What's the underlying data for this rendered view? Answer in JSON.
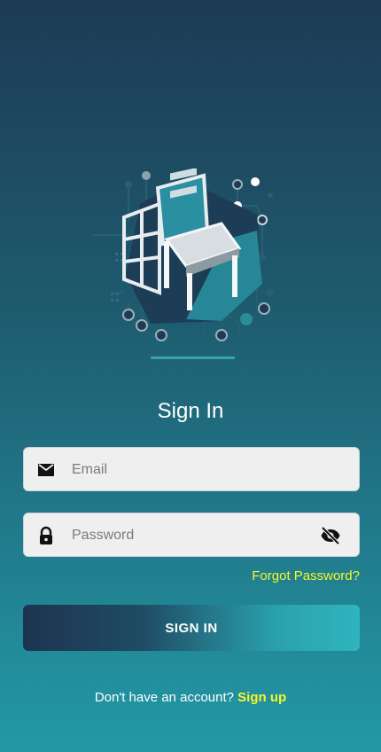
{
  "logo": {
    "icon": "chair-circuit-logo"
  },
  "signin": {
    "title": "Sign In",
    "email_placeholder": "Email",
    "password_placeholder": "Password",
    "forgot_label": "Forgot Password?",
    "button_label": "SIGN IN",
    "footer_text": "Don't have an account? ",
    "signup_label": "Sign up"
  },
  "colors": {
    "accent_yellow": "#f6f62a",
    "bg_top": "#1d3b55",
    "bg_bottom": "#2399a6",
    "field_bg": "#efefef"
  }
}
